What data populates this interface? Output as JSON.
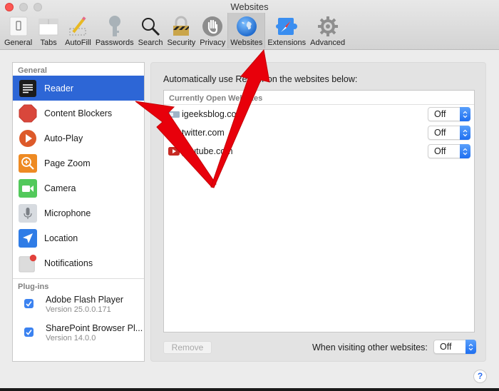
{
  "window": {
    "title": "Websites"
  },
  "toolbar": {
    "tabs": [
      {
        "label": "General",
        "icon": "general-switch-icon"
      },
      {
        "label": "Tabs",
        "icon": "tabs-icon"
      },
      {
        "label": "AutoFill",
        "icon": "pencil-icon"
      },
      {
        "label": "Passwords",
        "icon": "key-icon"
      },
      {
        "label": "Search",
        "icon": "magnifier-icon"
      },
      {
        "label": "Security",
        "icon": "padlock-icon"
      },
      {
        "label": "Privacy",
        "icon": "hand-icon"
      },
      {
        "label": "Websites",
        "icon": "globe-icon",
        "active": true
      },
      {
        "label": "Extensions",
        "icon": "puzzle-compass-icon"
      },
      {
        "label": "Advanced",
        "icon": "gear-icon"
      }
    ]
  },
  "sidebar": {
    "general_header": "General",
    "items": [
      {
        "label": "Reader",
        "icon": "reader-icon",
        "selected": true
      },
      {
        "label": "Content Blockers",
        "icon": "stop-sign-icon"
      },
      {
        "label": "Auto-Play",
        "icon": "play-icon"
      },
      {
        "label": "Page Zoom",
        "icon": "zoom-icon"
      },
      {
        "label": "Camera",
        "icon": "camera-icon"
      },
      {
        "label": "Microphone",
        "icon": "microphone-icon"
      },
      {
        "label": "Location",
        "icon": "location-arrow-icon"
      },
      {
        "label": "Notifications",
        "icon": "notifications-icon"
      }
    ],
    "plugins_header": "Plug-ins",
    "plugins": [
      {
        "name": "Adobe Flash Player",
        "version": "Version 25.0.0.171",
        "checked": true
      },
      {
        "name": "SharePoint Browser Pl...",
        "version": "Version 14.0.0",
        "checked": true
      }
    ]
  },
  "main": {
    "description": "Automatically use Reader on the websites below:",
    "list_header": "Currently Open Websites",
    "websites": [
      {
        "domain": "igeeksblog.com",
        "setting": "Off",
        "icon": "igeeksblog-favicon"
      },
      {
        "domain": "twitter.com",
        "setting": "Off",
        "icon": "twitter-favicon"
      },
      {
        "domain": "youtube.com",
        "setting": "Off",
        "icon": "youtube-favicon"
      }
    ],
    "remove_label": "Remove",
    "other_websites_label": "When visiting other websites:",
    "other_websites_setting": "Off"
  },
  "help_label": "?",
  "colors": {
    "selection": "#2d66d6",
    "accent_blue": "#2a6df0",
    "annotation_red": "#e8000b",
    "close_button": "#fc5753"
  }
}
